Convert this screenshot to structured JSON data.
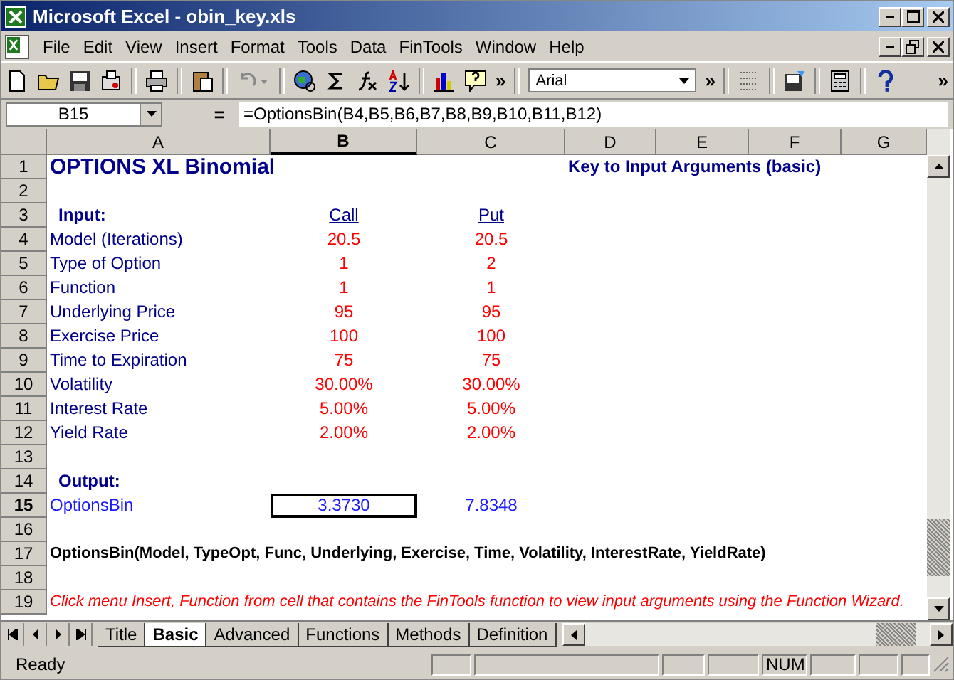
{
  "window": {
    "title": "Microsoft Excel - obin_key.xls"
  },
  "menu": [
    "File",
    "Edit",
    "View",
    "Insert",
    "Format",
    "Tools",
    "Data",
    "FinTools",
    "Window",
    "Help"
  ],
  "toolbar": {
    "overflow": "»",
    "font": "Arial",
    "overflow_2": "»",
    "overflow_3": "»"
  },
  "formula_bar": {
    "name_box": "B15",
    "equals": "=",
    "formula": "=OptionsBin(B4,B5,B6,B7,B8,B9,B10,B11,B12)"
  },
  "sheet": {
    "columns": [
      "A",
      "B",
      "C",
      "D",
      "E",
      "F",
      "G"
    ],
    "rows": [
      {
        "num": "1",
        "cells": [
          {
            "text": "OPTIONS XL Binomial",
            "kind": "title",
            "selected": false
          },
          "",
          "",
          {
            "text": "Key to Input Arguments (basic)",
            "kind": "key",
            "selected": false
          }
        ]
      },
      {
        "num": "2",
        "cells": []
      },
      {
        "num": "3",
        "cells": [
          {
            "text": "Input:",
            "kind": "heading",
            "selected": false
          },
          {
            "text": "Call",
            "kind": "colhead",
            "selected": false
          },
          {
            "text": "Put",
            "kind": "colhead",
            "selected": false
          }
        ]
      },
      {
        "num": "4",
        "cells": [
          {
            "text": "Model (Iterations)",
            "kind": "label",
            "selected": false
          },
          {
            "text": "20.5",
            "kind": "input",
            "selected": false
          },
          {
            "text": "20.5",
            "kind": "input",
            "selected": false
          }
        ]
      },
      {
        "num": "5",
        "cells": [
          {
            "text": "Type of Option",
            "kind": "label",
            "selected": false
          },
          {
            "text": "1",
            "kind": "input",
            "selected": false
          },
          {
            "text": "2",
            "kind": "input",
            "selected": false
          }
        ]
      },
      {
        "num": "6",
        "cells": [
          {
            "text": "Function",
            "kind": "label",
            "selected": false
          },
          {
            "text": "1",
            "kind": "input",
            "selected": false
          },
          {
            "text": "1",
            "kind": "input",
            "selected": false
          }
        ]
      },
      {
        "num": "7",
        "cells": [
          {
            "text": "Underlying Price",
            "kind": "label",
            "selected": false
          },
          {
            "text": "95",
            "kind": "input",
            "selected": false
          },
          {
            "text": "95",
            "kind": "input",
            "selected": false
          }
        ]
      },
      {
        "num": "8",
        "cells": [
          {
            "text": "Exercise Price",
            "kind": "label",
            "selected": false
          },
          {
            "text": "100",
            "kind": "input",
            "selected": false
          },
          {
            "text": "100",
            "kind": "input",
            "selected": false
          }
        ]
      },
      {
        "num": "9",
        "cells": [
          {
            "text": "Time to Expiration",
            "kind": "label",
            "selected": false
          },
          {
            "text": "75",
            "kind": "input",
            "selected": false
          },
          {
            "text": "75",
            "kind": "input",
            "selected": false
          }
        ]
      },
      {
        "num": "10",
        "cells": [
          {
            "text": "Volatility",
            "kind": "label",
            "selected": false
          },
          {
            "text": "30.00%",
            "kind": "input",
            "selected": false
          },
          {
            "text": "30.00%",
            "kind": "input",
            "selected": false
          }
        ]
      },
      {
        "num": "11",
        "cells": [
          {
            "text": "Interest Rate",
            "kind": "label",
            "selected": false
          },
          {
            "text": "5.00%",
            "kind": "input",
            "selected": false
          },
          {
            "text": "5.00%",
            "kind": "input",
            "selected": false
          }
        ]
      },
      {
        "num": "12",
        "cells": [
          {
            "text": "Yield Rate",
            "kind": "label",
            "selected": false
          },
          {
            "text": "2.00%",
            "kind": "input",
            "selected": false
          },
          {
            "text": "2.00%",
            "kind": "input",
            "selected": false
          }
        ]
      },
      {
        "num": "13",
        "cells": []
      },
      {
        "num": "14",
        "cells": [
          {
            "text": "Output:",
            "kind": "heading",
            "selected": false
          }
        ]
      },
      {
        "num": "15",
        "cells": [
          {
            "text": "OptionsBin",
            "kind": "outlabel",
            "selected": false
          },
          {
            "text": "3.3730",
            "kind": "output",
            "selected": true
          },
          {
            "text": "7.8348",
            "kind": "output",
            "selected": false
          }
        ]
      },
      {
        "num": "16",
        "cells": []
      },
      {
        "num": "17",
        "cells": [
          {
            "text": "OptionsBin(Model, TypeOpt, Func, Underlying, Exercise, Time, Volatility, InterestRate, YieldRate)",
            "kind": "formula",
            "selected": false
          }
        ]
      },
      {
        "num": "18",
        "cells": []
      },
      {
        "num": "19",
        "cells": [
          {
            "text": "Click menu Insert, Function from cell that contains the FinTools function to view input arguments using the Function Wizard.",
            "kind": "note",
            "selected": false
          }
        ]
      }
    ]
  },
  "sheet_tabs": [
    {
      "label": "Title",
      "selected": false
    },
    {
      "label": "Basic",
      "selected": true
    },
    {
      "label": "Advanced",
      "selected": false
    },
    {
      "label": "Functions",
      "selected": false
    },
    {
      "label": "Methods",
      "selected": false
    },
    {
      "label": "Definition",
      "selected": false
    }
  ],
  "status_bar": {
    "status": "Ready",
    "indicator": "NUM"
  }
}
